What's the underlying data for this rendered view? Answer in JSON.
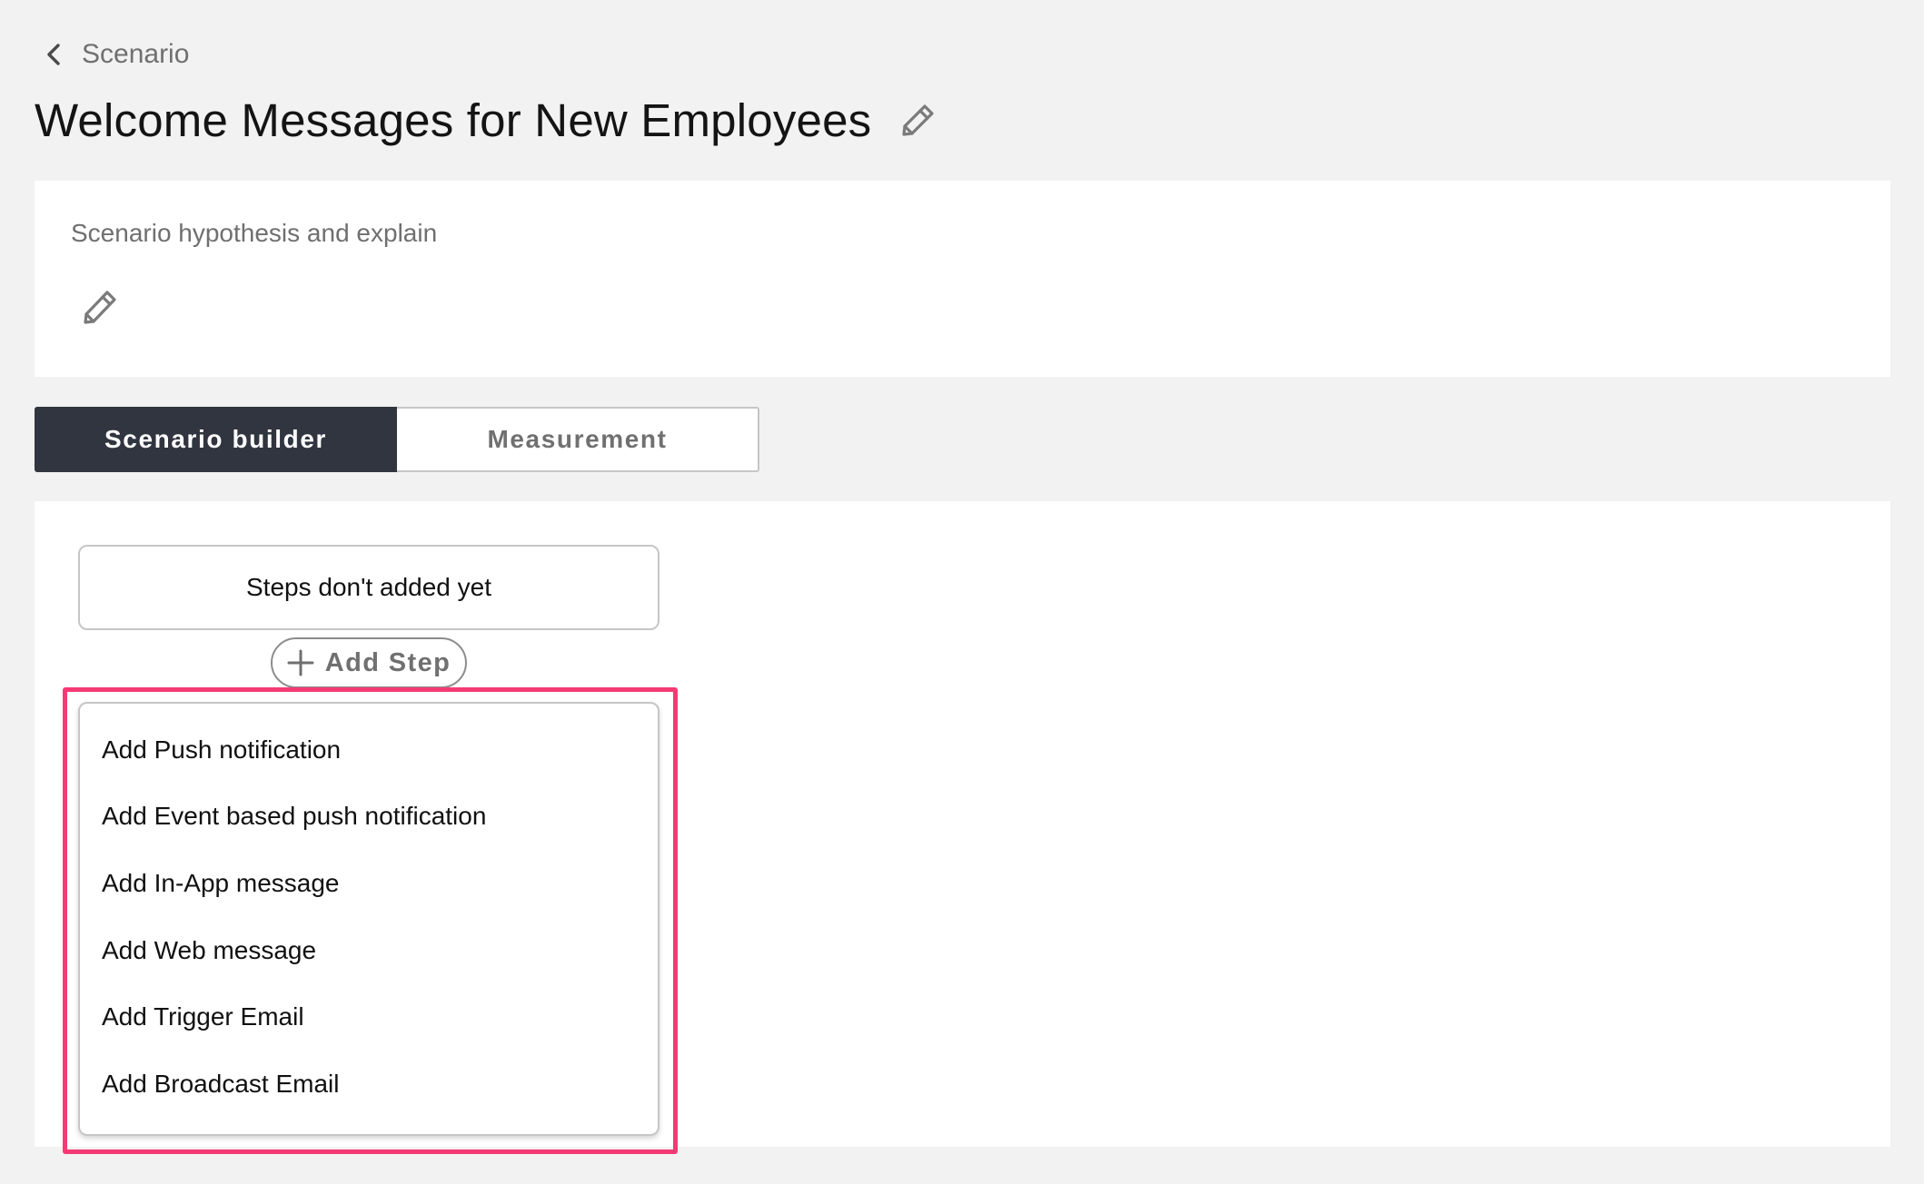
{
  "breadcrumb": {
    "back_icon": "chevron-left-icon",
    "label": "Scenario"
  },
  "header": {
    "title": "Welcome Messages for New Employees",
    "edit_icon": "pencil-icon"
  },
  "hypothesis": {
    "label": "Scenario hypothesis and explain",
    "edit_icon": "pencil-icon"
  },
  "tabs": [
    {
      "label": "Scenario builder",
      "active": true
    },
    {
      "label": "Measurement",
      "active": false
    }
  ],
  "builder": {
    "empty_state": "Steps don't added yet",
    "add_step_label": "Add Step",
    "add_step_icon": "plus-icon",
    "menu_items": [
      {
        "label": "Add Push notification"
      },
      {
        "label": "Add Event based push notification"
      },
      {
        "label": "Add In-App message"
      },
      {
        "label": "Add Web message"
      },
      {
        "label": "Add Trigger Email"
      },
      {
        "label": "Add Broadcast Email"
      }
    ]
  },
  "colors": {
    "page_background": "#f2f2f2",
    "active_tab": "#31353f",
    "highlight": "#f43a74"
  }
}
